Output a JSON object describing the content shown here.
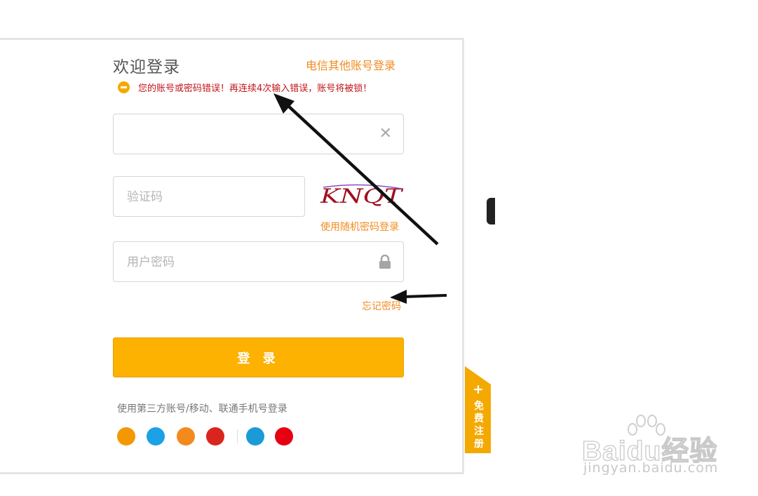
{
  "header": {
    "title": "欢迎登录",
    "other_login": "电信其他账号登录"
  },
  "error": {
    "message": "您的账号或密码错误！再连续4次输入错误，账号将被锁！"
  },
  "account": {
    "value": "",
    "placeholder": ""
  },
  "captcha": {
    "placeholder": "验证码",
    "image_text": "KNQT"
  },
  "random_password_login": "使用随机密码登录",
  "password": {
    "placeholder": "用户密码"
  },
  "forgot_password": "忘记密码",
  "login_button": "登 录",
  "third_party": {
    "label": "使用第三方账号/移动、联通手机号登录",
    "providers": [
      {
        "name": "tianyi",
        "color": "#f39800"
      },
      {
        "name": "alipay",
        "color": "#1aa1e6"
      },
      {
        "name": "weibo",
        "color": "#f38a1d"
      },
      {
        "name": "yi",
        "color": "#d9251d"
      },
      {
        "name": "china-mobile",
        "color": "#1a9bd7"
      },
      {
        "name": "china-unicom",
        "color": "#e60012"
      }
    ]
  },
  "register_tab": {
    "plus": "+",
    "label": "免费注册"
  },
  "watermark": {
    "brand": "Baidu经验",
    "url": "jingyan.baidu.com"
  },
  "colors": {
    "accent": "#f08b1f",
    "button": "#fdb100",
    "error": "#c0151b"
  }
}
